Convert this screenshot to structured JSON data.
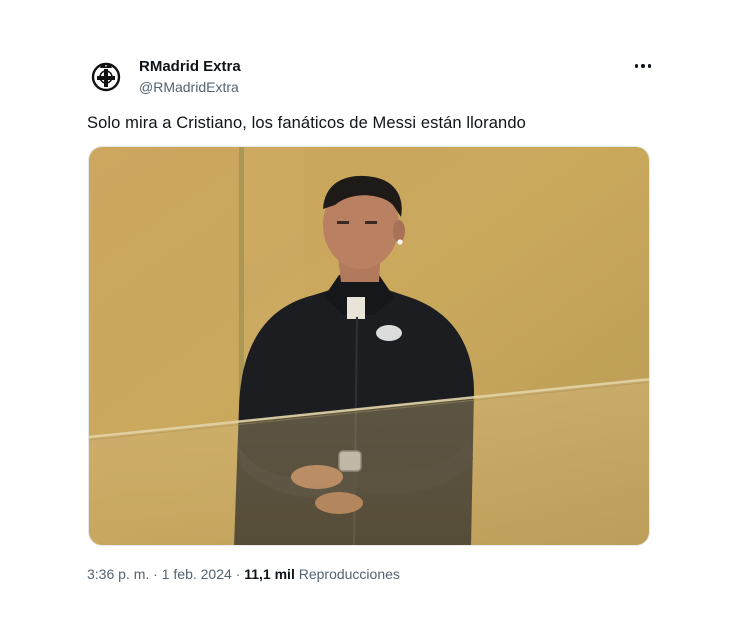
{
  "tweet": {
    "display_name": "RMadrid Extra",
    "handle": "@RMadridExtra",
    "text": "Solo mira a Cristiano, los fanáticos de Messi están llorando",
    "time": "3:36 p. m.",
    "separator": "·",
    "date": "1 feb. 2024",
    "views_count": "11,1 mil",
    "views_label": "Reproducciones"
  },
  "icons": {
    "avatar": "team-crest-icon",
    "more": "more-horizontal-icon"
  },
  "colors": {
    "text_primary": "#0f1419",
    "text_secondary": "#536471",
    "photo_background": "#c9a85a"
  }
}
